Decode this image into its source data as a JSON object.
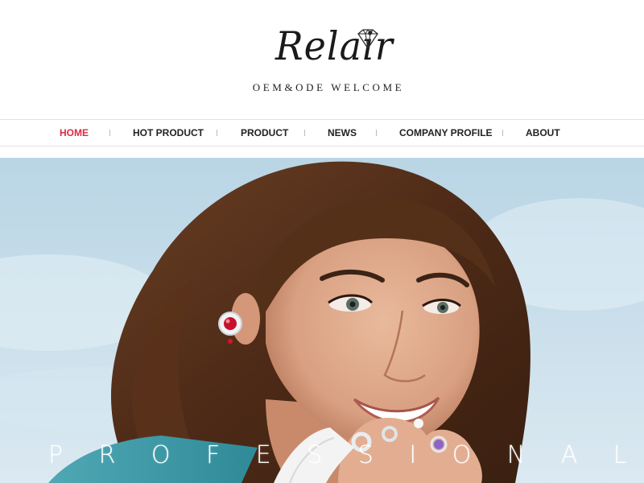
{
  "brand": {
    "name": "Relair",
    "tagline": "OEM&ODE WELCOME",
    "icon": "diamond-icon"
  },
  "nav": {
    "items": [
      {
        "label": "HOME",
        "active": true
      },
      {
        "label": "HOT PRODUCT",
        "active": false
      },
      {
        "label": "PRODUCT",
        "active": false
      },
      {
        "label": "NEWS",
        "active": false
      },
      {
        "label": "COMPANY PROFILE",
        "active": false
      },
      {
        "label": "ABOUT",
        "active": false
      }
    ]
  },
  "hero": {
    "caption": "PROFESSIONAL"
  },
  "colors": {
    "accent": "#d92b42",
    "text": "#222222",
    "sky": "#cfe3ee"
  }
}
